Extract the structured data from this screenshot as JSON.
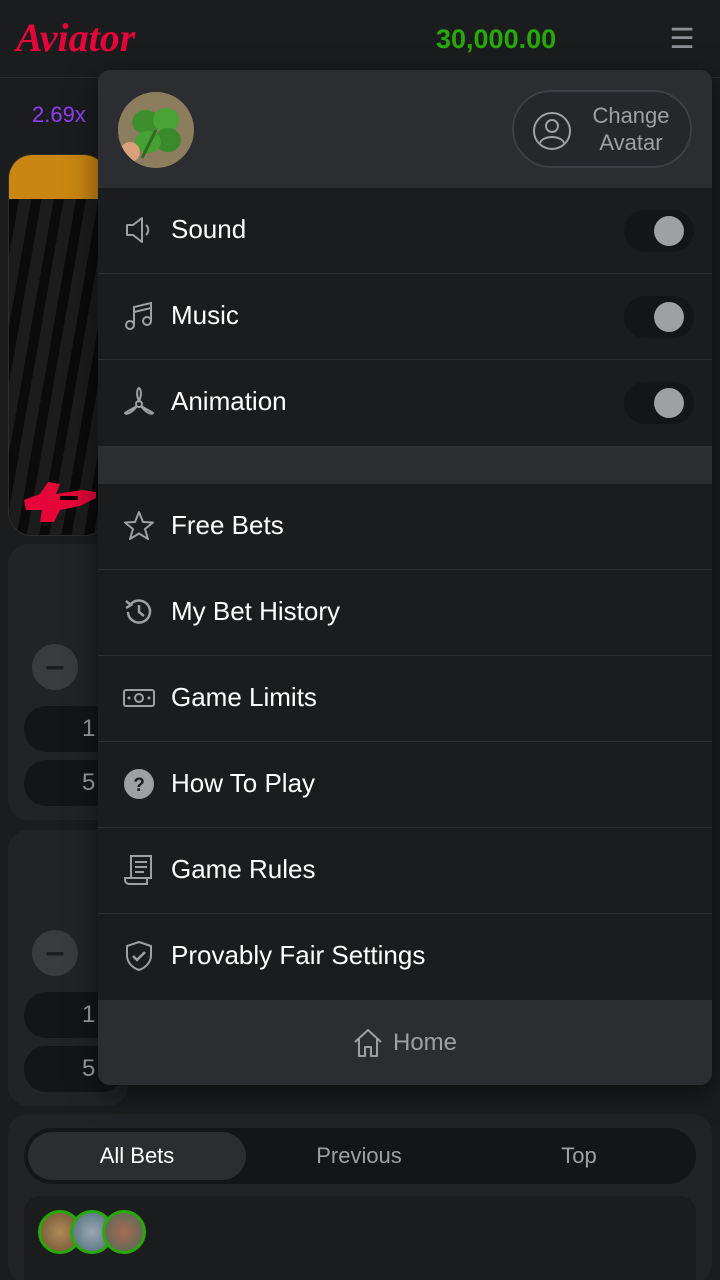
{
  "header": {
    "logo": "Aviator",
    "balance": "30,000.00"
  },
  "history": {
    "first_multiplier": "2.69x"
  },
  "bet_panels": [
    {
      "amount_preset_1": "1",
      "amount_preset_2": "5"
    },
    {
      "amount_preset_1": "1",
      "amount_preset_2": "5"
    }
  ],
  "bets_tabs": {
    "all_bets": "All Bets",
    "previous": "Previous",
    "top": "Top"
  },
  "menu": {
    "change_avatar_line1": "Change",
    "change_avatar_line2": "Avatar",
    "settings": [
      {
        "label": "Sound",
        "icon": "speaker-icon",
        "enabled": false
      },
      {
        "label": "Music",
        "icon": "music-note-icon",
        "enabled": false
      },
      {
        "label": "Animation",
        "icon": "propeller-icon",
        "enabled": false
      }
    ],
    "items": [
      {
        "label": "Free Bets",
        "icon": "star-icon"
      },
      {
        "label": "My Bet History",
        "icon": "history-icon"
      },
      {
        "label": "Game Limits",
        "icon": "banknote-icon"
      },
      {
        "label": "How To Play",
        "icon": "question-icon"
      },
      {
        "label": "Game Rules",
        "icon": "document-icon"
      },
      {
        "label": "Provably Fair Settings",
        "icon": "shield-check-icon"
      }
    ],
    "home": "Home"
  },
  "colors": {
    "logo": "#e50539",
    "balance": "#28a909",
    "multiplier": "#913ef8"
  }
}
